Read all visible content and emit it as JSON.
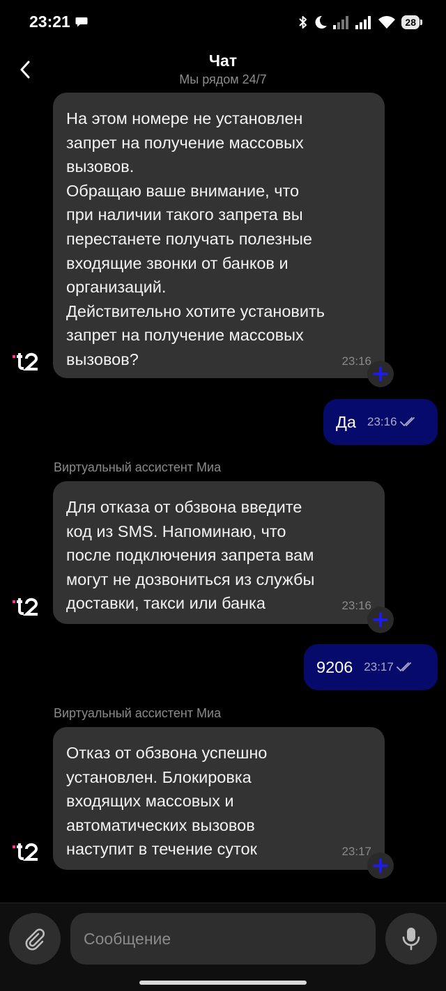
{
  "status_bar": {
    "time": "23:21",
    "battery": "28",
    "icons": [
      "message-icon",
      "bluetooth-icon",
      "moon-icon",
      "signal-icon",
      "signal-icon",
      "wifi-icon",
      "battery-icon"
    ]
  },
  "header": {
    "title": "Чат",
    "subtitle": "Мы рядом 24/7"
  },
  "messages": [
    {
      "direction": "in",
      "text": "На этом номере не установлен\nзапрет на получение массовых\nвызовов.\nОбращаю ваше внимание, что\nпри наличии такого запрета вы\nперестанете получать полезные\nвходящие звонки от банков и\nорганизаций.\nДействительно хотите установить\nзапрет на получение массовых\nвызовов?",
      "time": "23:16"
    },
    {
      "direction": "out",
      "text": "Да",
      "time": "23:16",
      "status": "read"
    },
    {
      "direction": "in",
      "sender": "Виртуальный ассистент Миа",
      "text": "Для отказа от обзвона введите\nкод из SMS. Напоминаю, что\nпосле подключения запрета вам\nмогут не дозвониться из службы\nдоставки, такси или банка",
      "time": "23:16"
    },
    {
      "direction": "out",
      "text": "9206",
      "time": "23:17",
      "status": "read"
    },
    {
      "direction": "in",
      "sender": "Виртуальный ассистент Миа",
      "text": "Отказ от обзвона успешно\nустановлен. Блокировка\nвходящих массовых и\nавтоматических вызовов\nнаступит в течение суток",
      "time": "23:17"
    }
  ],
  "input": {
    "placeholder": "Сообщение"
  },
  "colors": {
    "background": "#000000",
    "incoming_bubble": "#333333",
    "outgoing_bubble": "#060a6b",
    "accent_blue": "#1a1aff",
    "brand_pink": "#ff3495"
  }
}
